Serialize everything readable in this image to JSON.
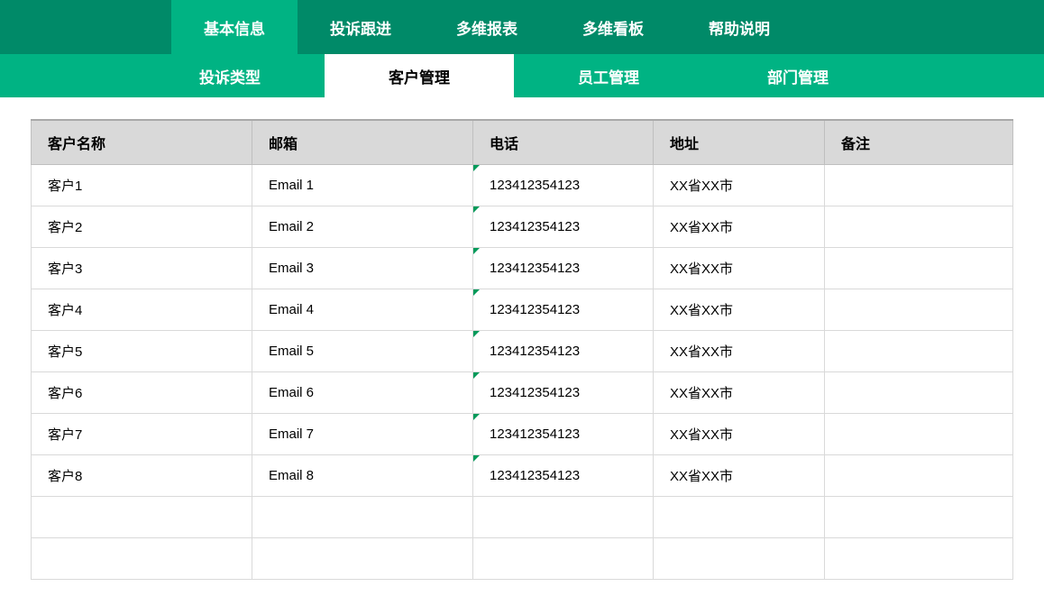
{
  "topnav": {
    "items": [
      {
        "label": "基本信息",
        "active": true
      },
      {
        "label": "投诉跟进",
        "active": false
      },
      {
        "label": "多维报表",
        "active": false
      },
      {
        "label": "多维看板",
        "active": false
      },
      {
        "label": "帮助说明",
        "active": false
      }
    ]
  },
  "subnav": {
    "items": [
      {
        "label": "投诉类型",
        "active": false
      },
      {
        "label": "客户管理",
        "active": true
      },
      {
        "label": "员工管理",
        "active": false
      },
      {
        "label": "部门管理",
        "active": false
      }
    ]
  },
  "table": {
    "columns": [
      "客户名称",
      "邮箱",
      "电话",
      "地址",
      "备注"
    ],
    "rows": [
      {
        "name": "客户1",
        "email": "Email 1",
        "phone": "123412354123",
        "addr": "XX省XX市",
        "note": ""
      },
      {
        "name": "客户2",
        "email": "Email 2",
        "phone": "123412354123",
        "addr": "XX省XX市",
        "note": ""
      },
      {
        "name": "客户3",
        "email": "Email 3",
        "phone": "123412354123",
        "addr": "XX省XX市",
        "note": ""
      },
      {
        "name": "客户4",
        "email": "Email 4",
        "phone": "123412354123",
        "addr": "XX省XX市",
        "note": ""
      },
      {
        "name": "客户5",
        "email": "Email 5",
        "phone": "123412354123",
        "addr": "XX省XX市",
        "note": ""
      },
      {
        "name": "客户6",
        "email": "Email 6",
        "phone": "123412354123",
        "addr": "XX省XX市",
        "note": ""
      },
      {
        "name": "客户7",
        "email": "Email 7",
        "phone": "123412354123",
        "addr": "XX省XX市",
        "note": ""
      },
      {
        "name": "客户8",
        "email": "Email 8",
        "phone": "123412354123",
        "addr": "XX省XX市",
        "note": ""
      }
    ],
    "empty_trailing_rows": 2
  }
}
